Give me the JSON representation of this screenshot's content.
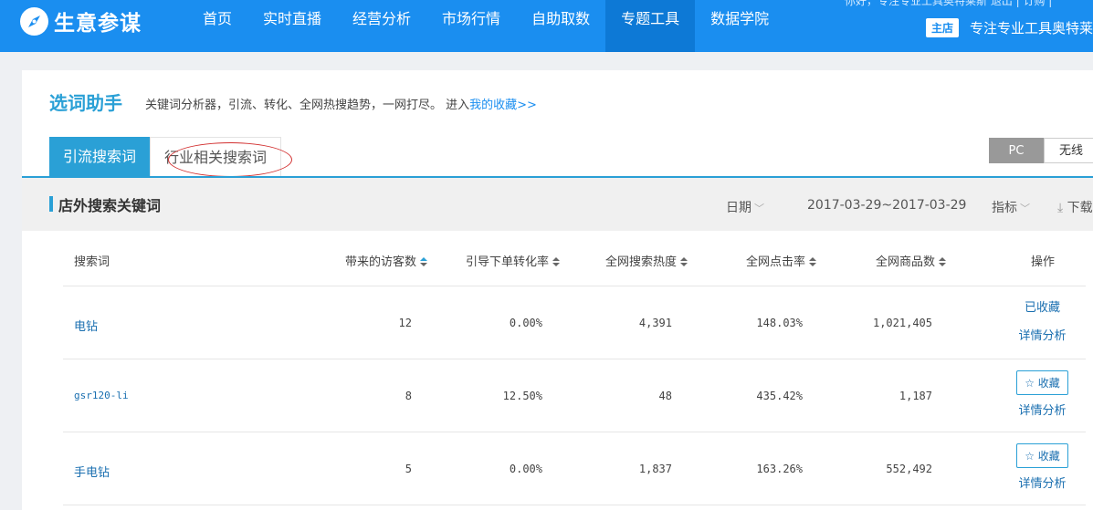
{
  "header": {
    "brand": "生意参谋",
    "nav": [
      "首页",
      "实时直播",
      "经营分析",
      "市场行情",
      "自助取数",
      "专题工具",
      "数据学院"
    ],
    "active_nav": "专题工具",
    "userbar": "你好，专注专业工具奥特莱斯    退出  |  订购  |",
    "shop_badge": "主店",
    "shop_name": "专注专业工具奥特莱"
  },
  "page": {
    "title": "选词助手",
    "desc": "关键词分析器，引流、转化、全网热搜趋势，一网打尽。 进入",
    "desc_link": "我的收藏>>",
    "tabs": [
      "引流搜索词",
      "行业相关搜索词"
    ],
    "device": [
      "PC",
      "无线"
    ]
  },
  "section": {
    "title": "店外搜索关键词",
    "date_label": "日期",
    "date_range": "2017-03-29~2017-03-29",
    "metric_label": "指标",
    "download_label": "下载"
  },
  "table": {
    "headers": [
      "搜索词",
      "带来的访客数",
      "引导下单转化率",
      "全网搜索热度",
      "全网点击率",
      "全网商品数",
      "操作"
    ],
    "rows": [
      {
        "kw": "电钻",
        "visitors": "12",
        "conv": "0.00%",
        "heat": "4,391",
        "ctr": "148.03%",
        "goods": "1,021,405",
        "fav": "已收藏",
        "detail": "详情分析"
      },
      {
        "kw": "gsr120-li",
        "visitors": "8",
        "conv": "12.50%",
        "heat": "48",
        "ctr": "435.42%",
        "goods": "1,187",
        "fav": "☆ 收藏",
        "detail": "详情分析"
      },
      {
        "kw": "手电钻",
        "visitors": "5",
        "conv": "0.00%",
        "heat": "1,837",
        "ctr": "163.26%",
        "goods": "552,492",
        "fav": "☆ 收藏",
        "detail": "详情分析"
      }
    ]
  }
}
